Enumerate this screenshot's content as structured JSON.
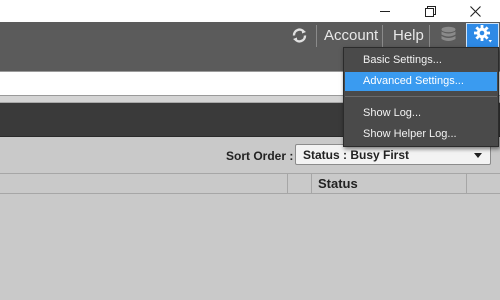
{
  "window": {
    "minimize_icon": "minimize-icon",
    "maximize_icon": "restore-icon",
    "close_icon": "close-icon"
  },
  "header": {
    "refresh_icon": "refresh-icon",
    "account_label": "Account",
    "help_label": "Help",
    "database_icon": "database-icon",
    "settings_icon": "gear-icon"
  },
  "settings_menu": {
    "items": [
      {
        "label": "Basic Settings..."
      },
      {
        "label": "Advanced Settings...",
        "highlighted": true
      },
      {
        "label": "Show Log..."
      },
      {
        "label": "Show Helper Log..."
      }
    ]
  },
  "sort": {
    "label": "Sort Order :",
    "selected": "Status : Busy First"
  },
  "table": {
    "columns": [
      "",
      "",
      "Status"
    ]
  },
  "colors": {
    "accent": "#2e8ae6",
    "menu_highlight": "#3a9bf0",
    "header_bg": "#5b5b5b",
    "menu_bg": "#4a4a4a"
  }
}
